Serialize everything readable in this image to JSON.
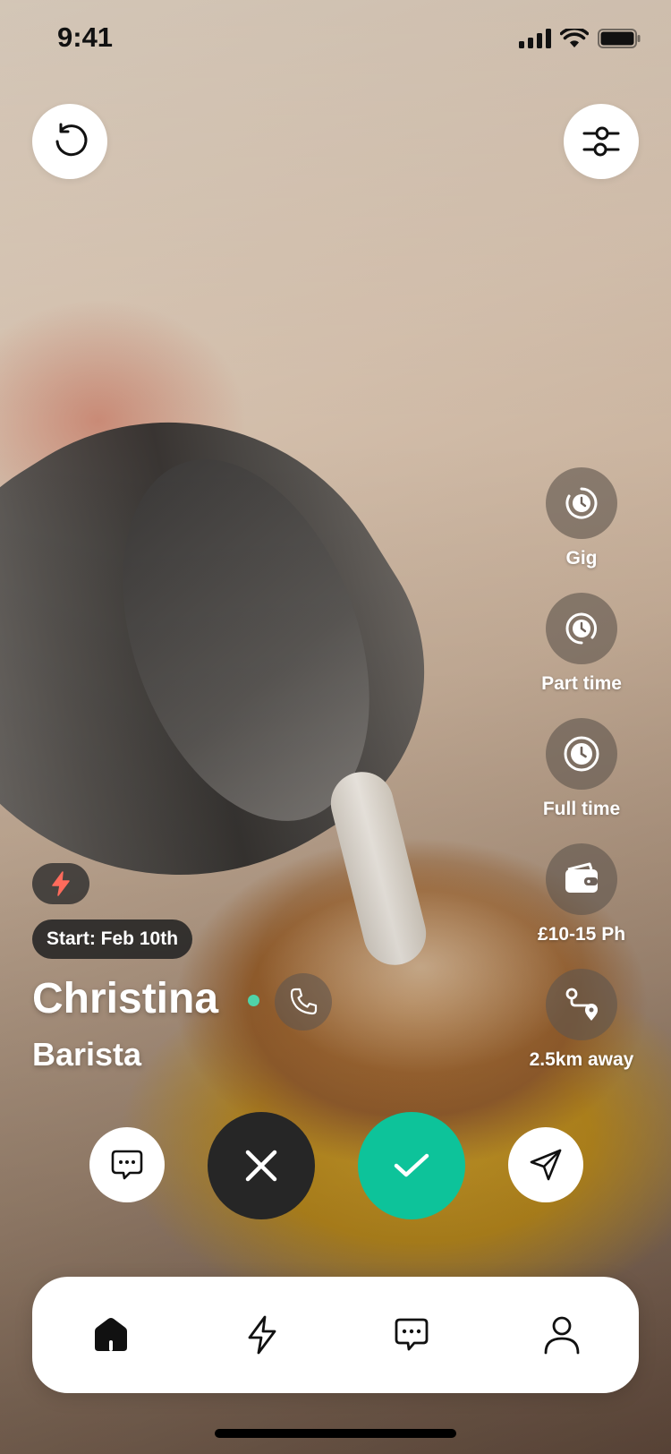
{
  "status_bar": {
    "time": "9:41"
  },
  "top_bar": {
    "undo_icon": "undo-icon",
    "filter_icon": "filters-icon"
  },
  "job_types": [
    {
      "label": "Gig",
      "icon": "clock-quarter-icon"
    },
    {
      "label": "Part time",
      "icon": "clock-half-icon"
    },
    {
      "label": "Full time",
      "icon": "clock-full-icon"
    },
    {
      "label": "£10-15 Ph",
      "icon": "wallet-icon"
    },
    {
      "label": "2.5km away",
      "icon": "route-icon"
    }
  ],
  "profile": {
    "badge_icon": "bolt-icon",
    "start_chip": "Start: Feb 10th",
    "name": "Christina",
    "online": true,
    "role": "Barista"
  },
  "actions": {
    "chat_icon": "chat-icon",
    "reject_icon": "close-icon",
    "accept_icon": "check-icon",
    "send_icon": "send-icon"
  },
  "tab_bar": {
    "items": [
      "home-icon",
      "bolt-icon",
      "chat-icon",
      "profile-icon"
    ],
    "active": "home-icon"
  },
  "colors": {
    "accent": "#0dc39a",
    "reject": "#262626",
    "online": "#4fd3a8",
    "bolt": "#ff6b5c"
  }
}
